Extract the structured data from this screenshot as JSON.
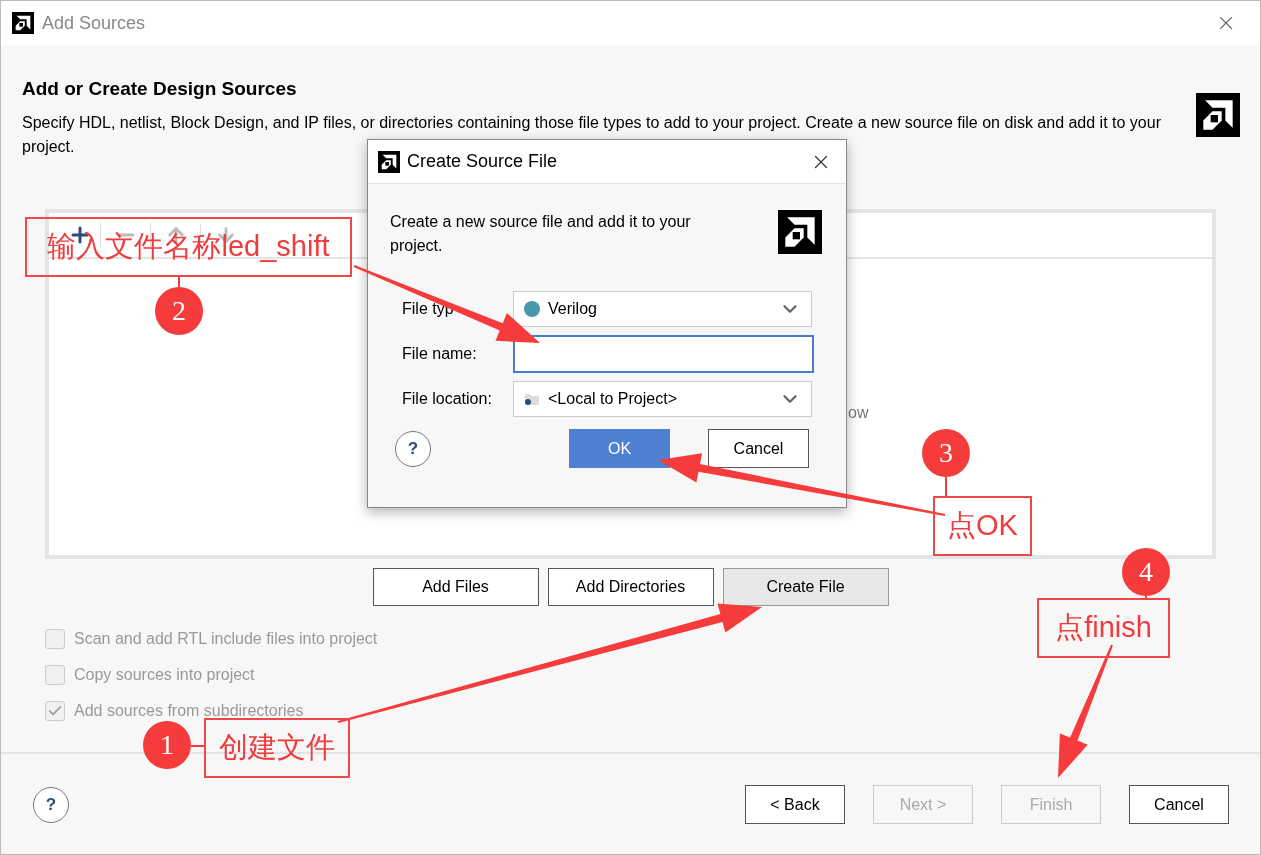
{
  "window": {
    "title": "Add Sources",
    "help_label": "?"
  },
  "header": {
    "title": "Add or Create Design Sources",
    "description": "Specify HDL, netlist, Block Design, and IP files, or directories containing those file types to add to your project. Create a new source file on disk and add it to your project."
  },
  "sources_panel": {
    "hint": "ow"
  },
  "actions": [
    {
      "label": "Add Files",
      "highlighted": false
    },
    {
      "label": "Add Directories",
      "highlighted": false
    },
    {
      "label": "Create File",
      "highlighted": true
    }
  ],
  "options": [
    {
      "label": "Scan and add RTL include files into project",
      "checked": false,
      "disabled": true
    },
    {
      "label": "Copy sources into project",
      "checked": false,
      "disabled": true
    },
    {
      "label": "Add sources from subdirectories",
      "checked": true,
      "disabled": true
    }
  ],
  "footer_buttons": [
    {
      "label": "< Back",
      "disabled": false
    },
    {
      "label": "Next >",
      "disabled": true
    },
    {
      "label": "Finish",
      "disabled": true
    },
    {
      "label": "Cancel",
      "disabled": false
    }
  ],
  "dialog": {
    "title": "Create Source File",
    "description": "Create a new source file and add it to your project.",
    "fields": [
      {
        "kind": "select",
        "label": "File typ",
        "value": "Verilog"
      },
      {
        "kind": "text",
        "label": "File name:"
      },
      {
        "kind": "select",
        "label": "File location:",
        "value": "<Local to Project>"
      }
    ],
    "help_label": "?",
    "buttons": [
      {
        "label": "OK",
        "primary": true
      },
      {
        "label": "Cancel",
        "primary": false
      }
    ]
  },
  "annotations": [
    {
      "number": "2",
      "text": "输入文件名称led_shift"
    },
    {
      "number": "3",
      "text": "点OK"
    },
    {
      "number": "1",
      "text": "创建文件"
    },
    {
      "number": "4",
      "text": "点finish"
    }
  ]
}
